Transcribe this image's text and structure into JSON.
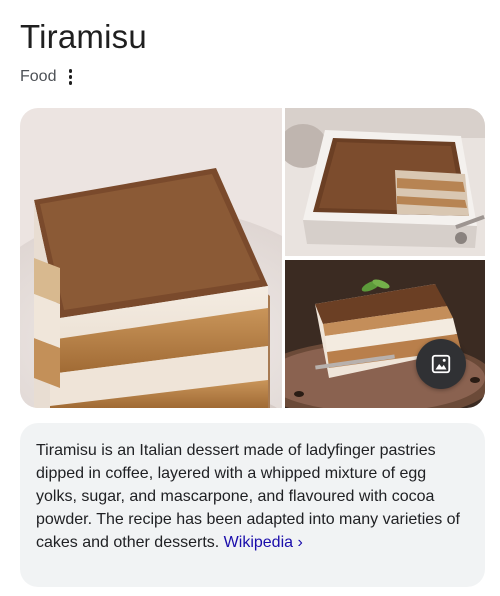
{
  "entity": {
    "title": "Tiramisu",
    "category": "Food"
  },
  "icons": {
    "more": "more-vert-icon",
    "images": "image-icon"
  },
  "gallery": {
    "images": [
      {
        "subject": "tiramisu slice square"
      },
      {
        "subject": "tiramisu dish with serving removed"
      },
      {
        "subject": "tiramisu slice with mint on plate"
      }
    ]
  },
  "description": {
    "text": "Tiramisu is an Italian dessert made of ladyfinger pastries dipped in coffee, layered with a whipped mixture of egg yolks, sugar, and mascarpone, and flavoured with cocoa powder. The recipe has been adapted into many varieties of cakes and other desserts. ",
    "source_label": "Wikipedia",
    "source_chevron": "›"
  },
  "colors": {
    "card_background": "#f1f3f4",
    "link": "#1a0dab",
    "images_button": "#303134"
  }
}
